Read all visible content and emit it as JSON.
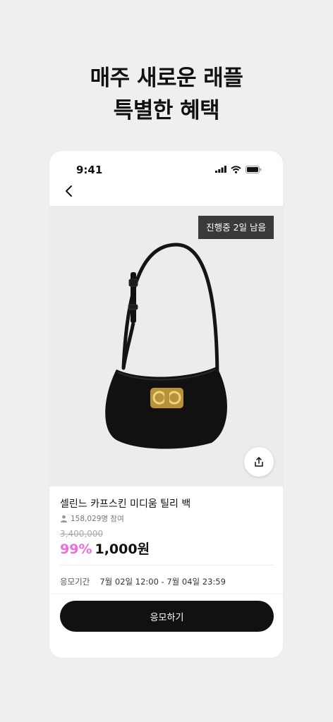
{
  "headline": {
    "line1": "매주 새로운 래플",
    "line2": "특별한 혜택"
  },
  "status_bar": {
    "time": "9:41"
  },
  "icons": {
    "back": "chevron-left-icon",
    "share": "share-icon",
    "person": "person-icon",
    "signal": "signal-icon",
    "wifi": "wifi-icon",
    "battery": "battery-icon"
  },
  "product": {
    "badge": "진행중 2일 남음",
    "name": "셀린느 카프스킨 미디움 틸리 백",
    "participants": "158,029명 참여",
    "original_price": "3,400,000",
    "discount": "99%",
    "price": "1,000원",
    "period_label": "응모기간",
    "period_value": "7월 02일 12:00 - 7월 04일 23:59"
  },
  "cta": {
    "label": "응모하기"
  },
  "colors": {
    "discount": "#f06ce0",
    "button": "#111111",
    "image_bg": "#ececec"
  }
}
